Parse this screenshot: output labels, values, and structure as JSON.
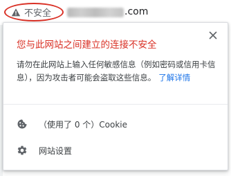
{
  "address_bar": {
    "security_label": "不安全",
    "domain_suffix": ".com"
  },
  "bubble": {
    "title": "您与此网站之间建立的连接不安全",
    "body_text": "请勿在此网站上输入任何敏感信息（例如密码或信用卡信息），因为攻击者可能会盗取这些信息。",
    "learn_more_label": "了解详情",
    "cookies_label": "（使用了 0 个）Cookie",
    "site_settings_label": "网站设置"
  },
  "colors": {
    "danger": "#d93025",
    "link": "#1a73e8",
    "text": "#3c4043",
    "icon": "#5f6368"
  },
  "icons": {
    "security_chip": "warning-triangle-icon",
    "close": "close-icon",
    "cookies": "cookie-icon",
    "site_settings": "gear-icon"
  }
}
